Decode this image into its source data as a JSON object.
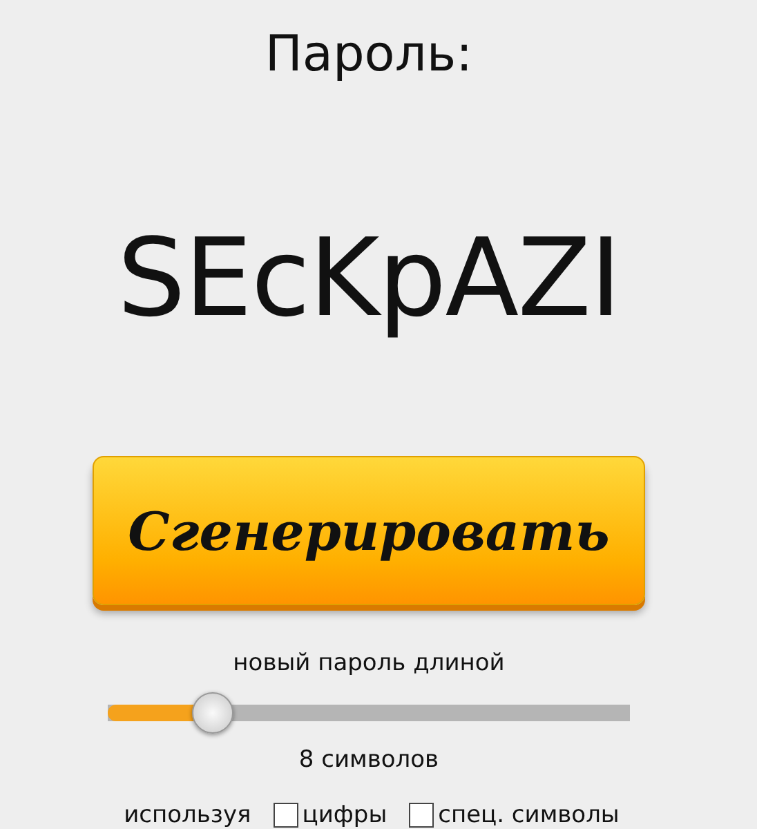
{
  "title": "Пароль:",
  "password": "SEcKpAZI",
  "generate_button": {
    "label": "Сгенерировать"
  },
  "length": {
    "label": "новый пароль длиной",
    "level": 0.2,
    "reading": "8 символов"
  },
  "options": {
    "label": "используя",
    "items": [
      {
        "label": "цифры",
        "checked": false
      },
      {
        "label": "спец. символы",
        "checked": false
      }
    ]
  }
}
